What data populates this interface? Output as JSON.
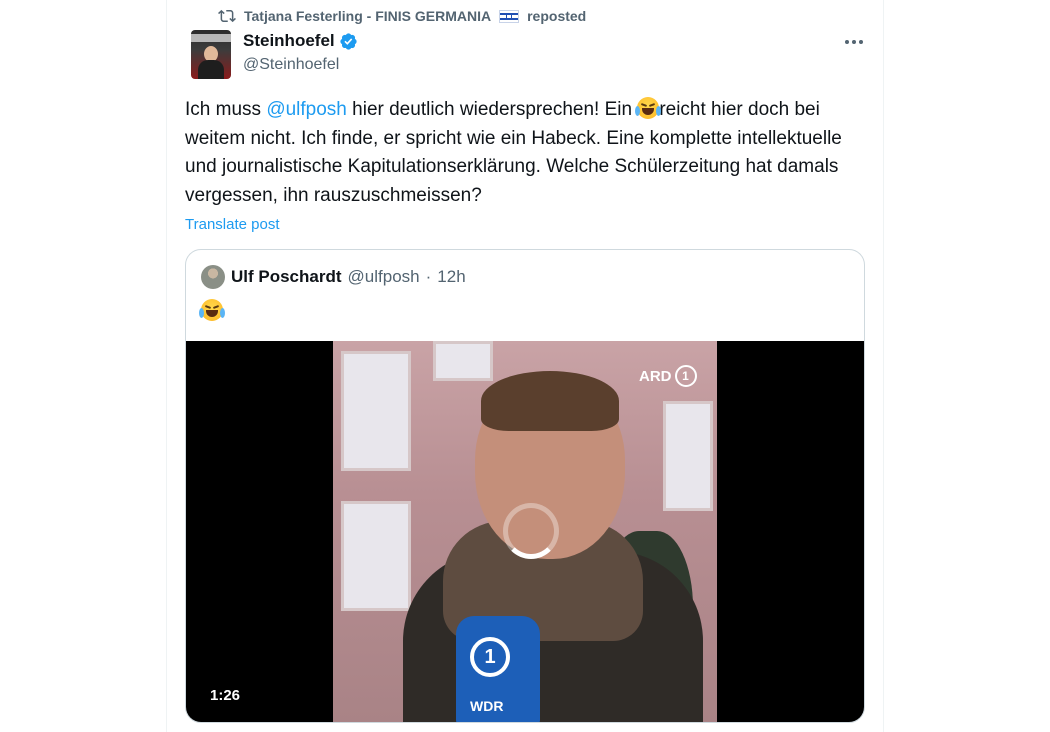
{
  "repost": {
    "reposter": "Tatjana Festerling - FINIS GERMANIA",
    "flag": "🇮🇱",
    "label": "reposted"
  },
  "author": {
    "display_name": "Steinhoefel",
    "handle": "@Steinhoefel",
    "verified": true
  },
  "post": {
    "text_part1": "Ich muss ",
    "mention": "@ulfposh",
    "text_part2": " hier deutlich wiedersprechen! Ein ",
    "emoji": "😂",
    "text_part3": "reicht hier doch bei weitem nicht. Ich finde, er spricht wie ein Habeck. Eine komplette intellektuelle und journalistische Kapitulationserklärung. Welche Schülerzeitung hat damals vergessen, ihn rauszuschmeissen?",
    "translate_label": "Translate post"
  },
  "quote": {
    "display_name": "Ulf Poschardt",
    "handle": "@ulfposh",
    "separator": "·",
    "time": "12h",
    "emoji": "😂",
    "video": {
      "duration": "1:26",
      "broadcaster": "ARD",
      "mic_label": "WDR"
    }
  },
  "colors": {
    "accent": "#1d9bf0",
    "secondary_text": "#536471",
    "primary_text": "#0f1419"
  }
}
